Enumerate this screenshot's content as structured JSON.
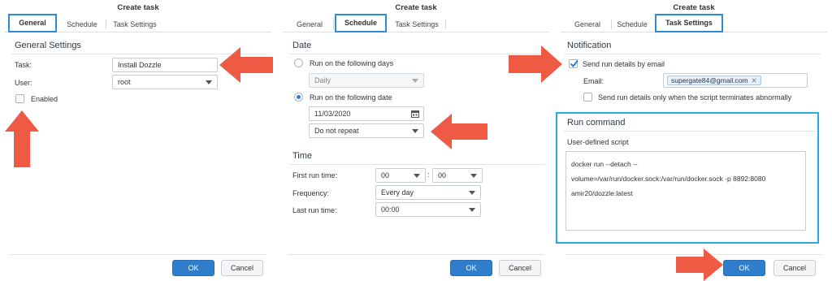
{
  "panels": {
    "general": {
      "title": "Create task",
      "tabs": [
        "General",
        "Schedule",
        "Task Settings"
      ],
      "section": "General Settings",
      "task_label": "Task:",
      "task_value": "Install Dozzle",
      "user_label": "User:",
      "user_value": "root",
      "enabled_label": "Enabled",
      "ok": "OK",
      "cancel": "Cancel"
    },
    "schedule": {
      "title": "Create task",
      "tabs": [
        "General",
        "Schedule",
        "Task Settings"
      ],
      "date_section": "Date",
      "run_days_label": "Run on the following days",
      "days_value": "Daily",
      "run_date_label": "Run on the following date",
      "date_value": "11/03/2020",
      "repeat_value": "Do not repeat",
      "time_section": "Time",
      "first_run_label": "First run time:",
      "hour_value": "00",
      "colon": ":",
      "minute_value": "00",
      "frequency_label": "Frequency:",
      "frequency_value": "Every day",
      "last_run_label": "Last run time:",
      "last_run_value": "00:00",
      "ok": "OK",
      "cancel": "Cancel"
    },
    "task_settings": {
      "title": "Create task",
      "tabs": [
        "General",
        "Schedule",
        "Task Settings"
      ],
      "notification_section": "Notification",
      "send_email_label": "Send run details by email",
      "email_label": "Email:",
      "email_chip": "supergate84@gmail.com",
      "abnormal_label": "Send run details only when the script terminates abnormally",
      "run_section": "Run command",
      "script_label": "User-defined script",
      "script_lines": [
        "docker run --detach --",
        "volume=/var/run/docker.sock:/var/run/docker.sock -p 8892:8080",
        "amir20/dozzle:latest"
      ],
      "ok": "OK",
      "cancel": "Cancel"
    }
  },
  "colors": {
    "highlight": "#2e8bd6",
    "run_box": "#29a9e1",
    "arrow": "#ef5a45",
    "ok_button": "#2f7ecb"
  }
}
